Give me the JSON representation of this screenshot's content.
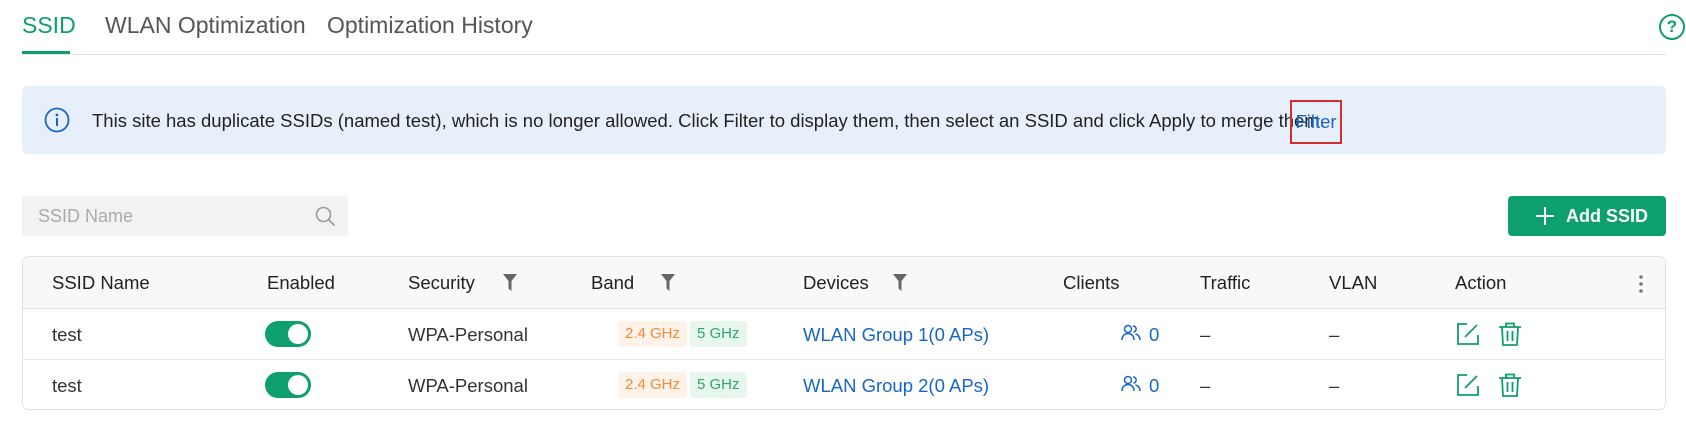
{
  "tabs": [
    {
      "label": "SSID",
      "active": true
    },
    {
      "label": "WLAN Optimization",
      "active": false
    },
    {
      "label": "Optimization History",
      "active": false
    }
  ],
  "help_icon": "question-circle-icon",
  "banner": {
    "icon": "info-icon",
    "text": "This site has duplicate SSIDs (named test), which is no longer allowed. Click Filter to display them, then select an SSID and click Apply to merge them.",
    "link_label": "Filter"
  },
  "search": {
    "placeholder": "SSID Name",
    "value": ""
  },
  "add_button": {
    "label": "Add SSID"
  },
  "table": {
    "headers": {
      "ssid_name": "SSID Name",
      "enabled": "Enabled",
      "security": "Security",
      "band": "Band",
      "devices": "Devices",
      "clients": "Clients",
      "traffic": "Traffic",
      "vlan": "VLAN",
      "action": "Action"
    },
    "rows": [
      {
        "ssid_name": "test",
        "enabled": true,
        "security": "WPA-Personal",
        "band_24": "2.4 GHz",
        "band_5": "5 GHz",
        "devices": "WLAN Group 1(0 APs)",
        "clients": "0",
        "traffic": "–",
        "vlan": "–"
      },
      {
        "ssid_name": "test",
        "enabled": true,
        "security": "WPA-Personal",
        "band_24": "2.4 GHz",
        "band_5": "5 GHz",
        "devices": "WLAN Group 2(0 APs)",
        "clients": "0",
        "traffic": "–",
        "vlan": "–"
      }
    ]
  },
  "colors": {
    "accent": "#0e9f6e",
    "link": "#1766c5",
    "banner_bg": "#e7f0fa",
    "highlight_border": "#d32f2f"
  }
}
